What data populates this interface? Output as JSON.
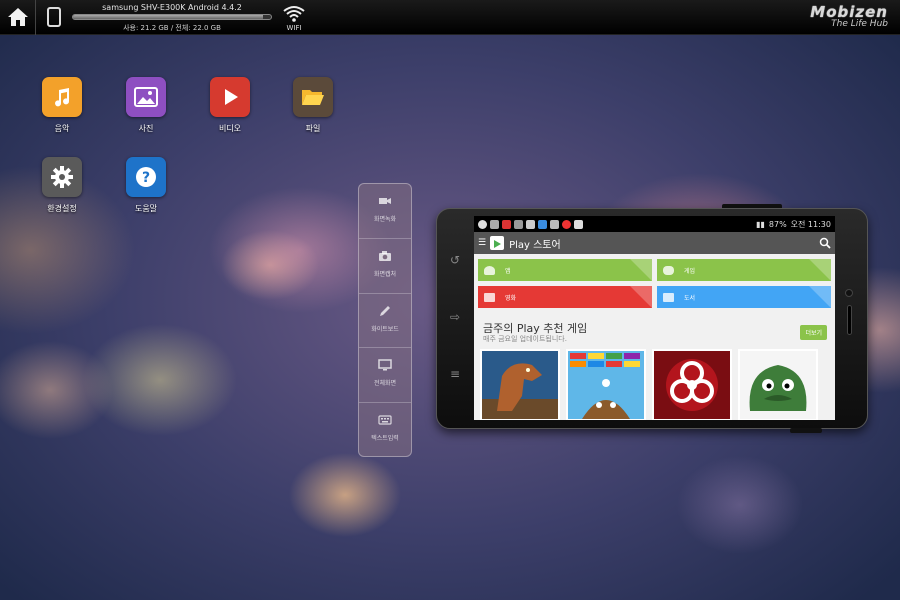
{
  "topbar": {
    "device_name": "samsung SHV-E300K Android 4.4.2",
    "storage_text": "사용: 21.2 GB / 전체: 22.0 GB",
    "storage_fraction": 0.96,
    "wifi_label": "WIFI",
    "logo": "Mobizen",
    "logo_tagline": "The Life Hub"
  },
  "desktop": {
    "icons": [
      {
        "label": "음악",
        "color": "#f3a12a",
        "icon": "music-icon"
      },
      {
        "label": "사진",
        "color": "#8e4fc1",
        "icon": "photo-icon"
      },
      {
        "label": "비디오",
        "color": "#d63a2f",
        "icon": "play-icon"
      },
      {
        "label": "파일",
        "color": "#5b4a3a",
        "icon": "folder-icon"
      },
      {
        "label": "환경설정",
        "color": "#5a5a5a",
        "icon": "gear-icon"
      },
      {
        "label": "도움말",
        "color": "#1e73c9",
        "icon": "question-icon"
      }
    ]
  },
  "toolbar": {
    "items": [
      {
        "label": "화면녹화",
        "icon": "video-camera-icon"
      },
      {
        "label": "화면캡처",
        "icon": "camera-icon"
      },
      {
        "label": "화이트보드",
        "icon": "pencil-icon"
      },
      {
        "label": "전체화면",
        "icon": "monitor-icon"
      },
      {
        "label": "텍스트입력",
        "icon": "keyboard-icon"
      }
    ]
  },
  "phone": {
    "status_time": "오전 11:30",
    "battery": "87%",
    "app_title": "Play 스토어",
    "categories": [
      {
        "label": "앱",
        "color": "#8bc34a"
      },
      {
        "label": "게임",
        "color": "#8bc34a"
      },
      {
        "label": "영화",
        "color": "#e53935"
      },
      {
        "label": "도서",
        "color": "#42a5f5"
      }
    ],
    "section_title": "금주의 Play 추천 게임",
    "section_subtitle": "매주 금요일 업데이트됩니다.",
    "more_label": "더보기",
    "games": [
      {
        "name": "dinosaur-game-icon"
      },
      {
        "name": "brick-game-icon"
      },
      {
        "name": "biohazard-game-icon"
      },
      {
        "name": "green-creature-game-icon"
      }
    ]
  }
}
